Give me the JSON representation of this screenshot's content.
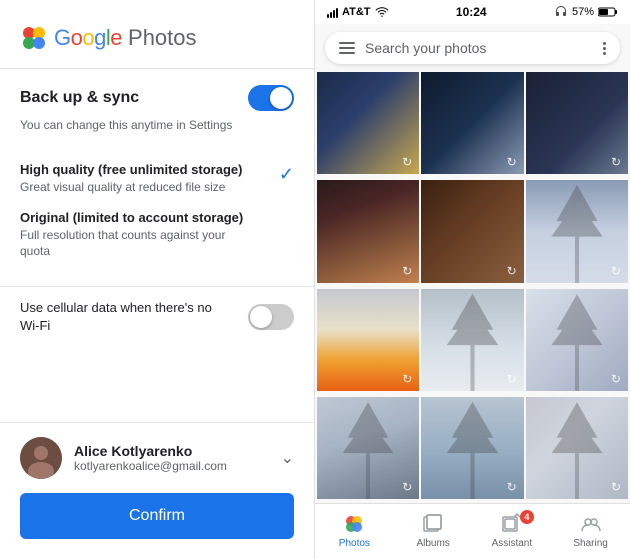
{
  "left": {
    "logo": {
      "google": "Google",
      "photos": "Photos"
    },
    "backup": {
      "title": "Back up & sync",
      "subtitle": "You can change this anytime in Settings",
      "toggle_on": true
    },
    "quality_options": [
      {
        "title": "High quality (free unlimited storage)",
        "desc": "Great visual quality at reduced file size",
        "selected": true
      },
      {
        "title": "Original (limited to account storage)",
        "desc": "Full resolution that counts against your quota",
        "selected": false
      }
    ],
    "cellular": {
      "label": "Use cellular data when there's no Wi-Fi",
      "toggle_on": false
    },
    "account": {
      "name": "Alice Kotlyarenko",
      "email": "kotlyarenkoalice@gmail.com"
    },
    "confirm_label": "Confirm"
  },
  "right": {
    "status_bar": {
      "signal": "AT&T",
      "time": "10:24",
      "battery": "57%"
    },
    "search": {
      "placeholder": "Search your photos"
    },
    "nav": {
      "items": [
        {
          "label": "Photos",
          "active": true,
          "badge": null
        },
        {
          "label": "Albums",
          "active": false,
          "badge": null
        },
        {
          "label": "Assistant",
          "active": false,
          "badge": "4"
        },
        {
          "label": "Sharing",
          "active": false,
          "badge": null
        }
      ]
    }
  }
}
